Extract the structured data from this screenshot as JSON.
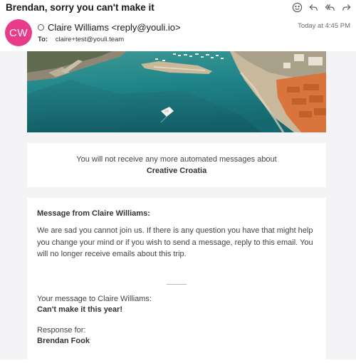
{
  "email": {
    "subject": "Brendan, sorry you can't make it",
    "avatar_initials": "CW",
    "from": "Claire Williams <reply@youli.io>",
    "to_label": "To:",
    "to": "claire+test@youli.team",
    "time": "Today at 4:45 PM",
    "actions": [
      {
        "icon": "emoji-icon"
      },
      {
        "icon": "reply-icon"
      },
      {
        "icon": "reply-all-icon"
      },
      {
        "icon": "forward-icon"
      }
    ]
  },
  "notice": {
    "line": "You will not receive any more automated messages about",
    "trip": "Creative Croatia"
  },
  "message": {
    "heading": "Message from Claire Williams:",
    "body": "We are sad you cannot join us. If there is any question you have that might help you change your mind or if you wish to send a message, reply to this email. You will no longer receive emails about this trip.",
    "your_message_label": "Your message to Claire Williams:",
    "your_message": "Can't make it this year!",
    "response_label": "Response for:",
    "response_name": "Brendan Fook"
  },
  "colors": {
    "avatar": "#e83b8a",
    "sea": "#1e8a8e",
    "roofs": "#d9743c",
    "background": "#f4f4f6"
  }
}
